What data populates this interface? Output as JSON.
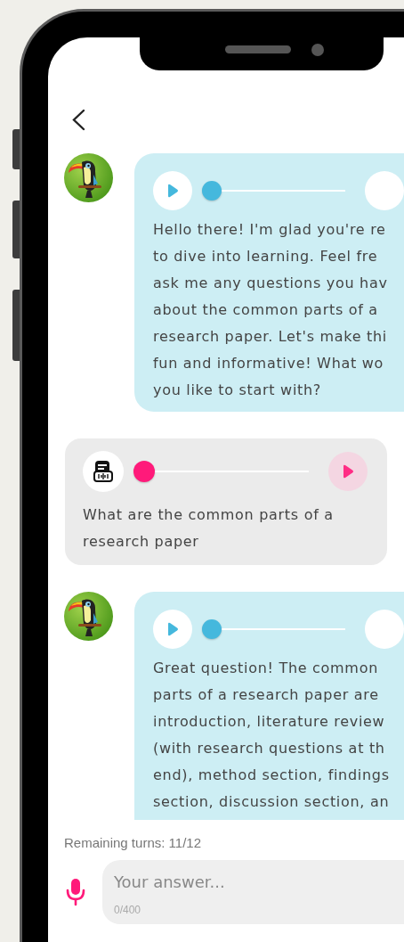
{
  "messages": [
    {
      "kind": "bot",
      "audio": {
        "level": 0
      },
      "lines": [
        "Hello there! I'm glad you're re",
        "to dive into learning. Feel fre",
        "ask me any questions you hav",
        "about the common parts of a",
        "research paper. Let's make thi",
        "fun and informative! What wo",
        "you like to start with?"
      ]
    },
    {
      "kind": "user",
      "audio": {
        "level": 0
      },
      "lines": [
        "What are the common parts of a",
        "research paper"
      ]
    },
    {
      "kind": "bot",
      "audio": {
        "level": 0
      },
      "lines": [
        "Great question! The common",
        "parts of a research paper are",
        "introduction, literature review",
        "(with research questions at th",
        "end), method section, findings",
        "section, discussion section, an"
      ]
    }
  ],
  "remaining_turns": "Remaining turns: 11/12",
  "answer": {
    "placeholder": "Your answer...",
    "counter": "0/400"
  }
}
